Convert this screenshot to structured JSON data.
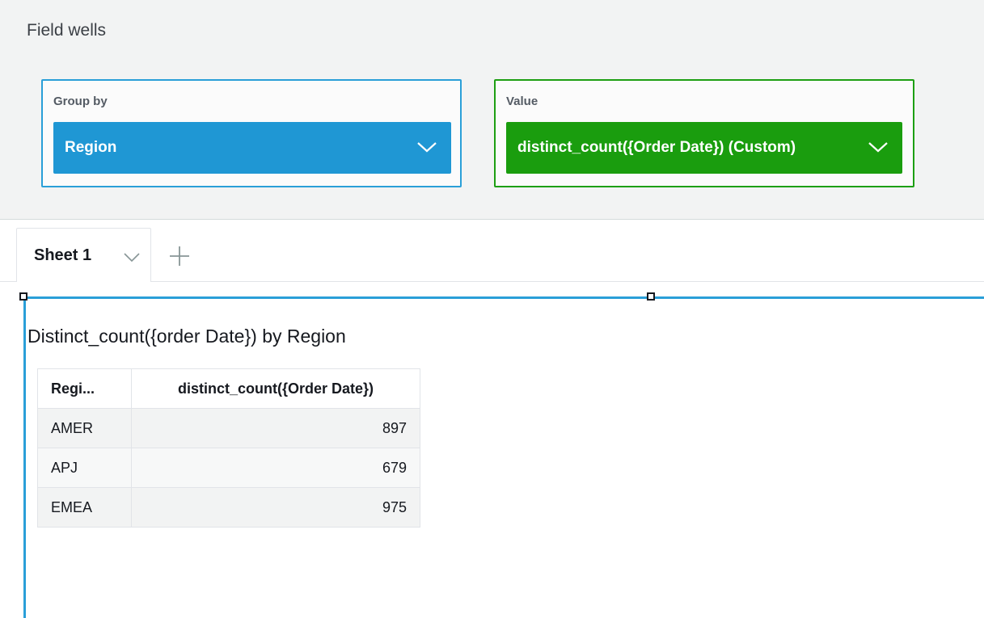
{
  "field_wells": {
    "title": "Field wells",
    "group_by": {
      "label": "Group by",
      "field": "Region",
      "color": "#1f97d4"
    },
    "value": {
      "label": "Value",
      "field": "distinct_count({Order Date}) (Custom)",
      "color": "#1a9d0e"
    }
  },
  "sheets": {
    "active_tab": "Sheet 1",
    "add_icon": "plus-icon"
  },
  "visual": {
    "title": "Distinct_count({order Date}) by Region",
    "table": {
      "headers": [
        "Regi...",
        "distinct_count({Order Date})"
      ],
      "rows": [
        {
          "region": "AMER",
          "count": "897"
        },
        {
          "region": "APJ",
          "count": "679"
        },
        {
          "region": "EMEA",
          "count": "975"
        }
      ]
    }
  }
}
